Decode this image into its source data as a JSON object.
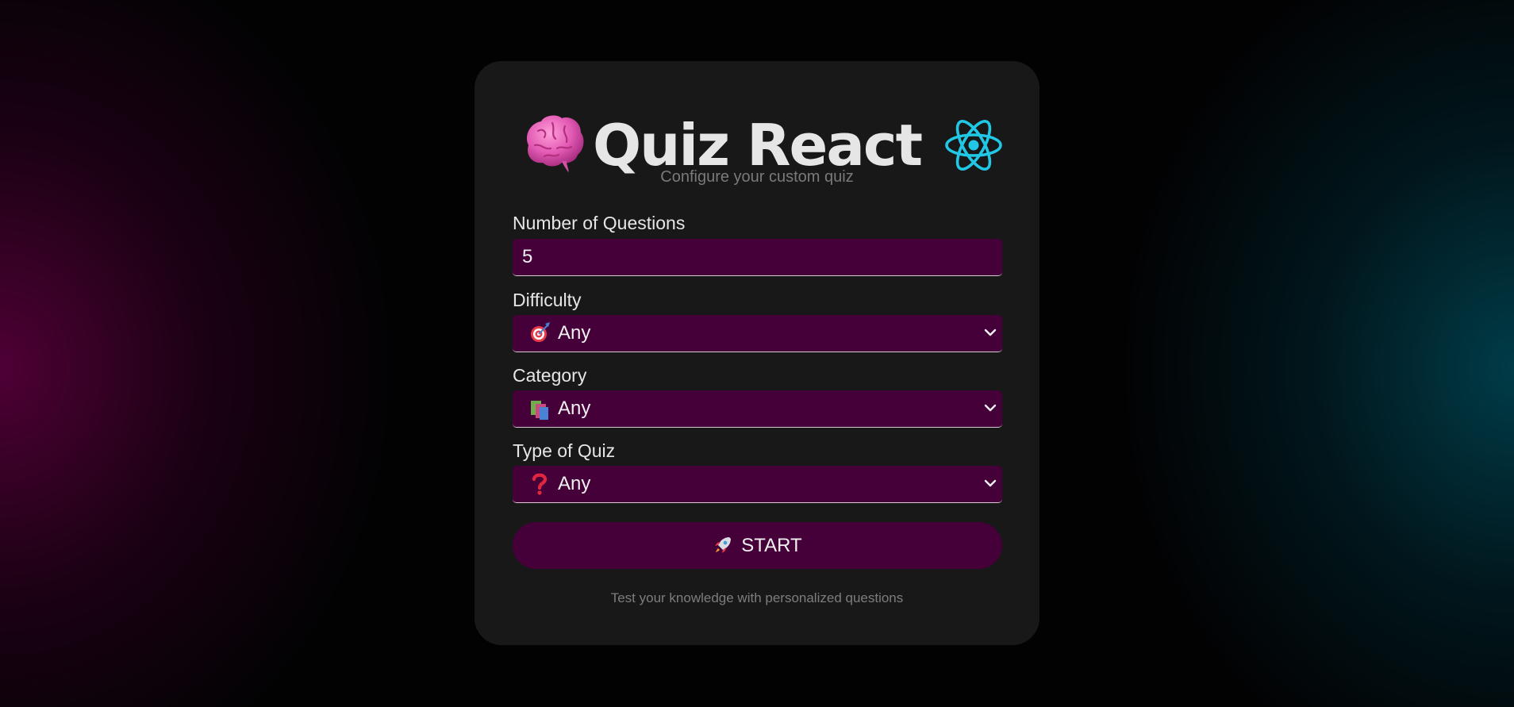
{
  "header": {
    "title": "Quiz React",
    "subtitle": "Configure your custom quiz",
    "left_icon": "brain-icon",
    "right_icon": "react-logo-icon"
  },
  "form": {
    "questions": {
      "label": "Number of Questions",
      "value": "5"
    },
    "difficulty": {
      "label": "Difficulty",
      "icon": "target-icon",
      "selected": "Any"
    },
    "category": {
      "label": "Category",
      "icon": "books-icon",
      "selected": "Any"
    },
    "type": {
      "label": "Type of Quiz",
      "icon": "question-mark-icon",
      "selected": "Any"
    },
    "start_button": {
      "label": "START",
      "icon": "rocket-icon"
    }
  },
  "footer": {
    "text": "Test your knowledge with personalized questions"
  },
  "colors": {
    "card_background": "#181818",
    "field_background": "#45003a",
    "react_cyan": "#21c8e6",
    "title_text": "#e6e6e6"
  }
}
